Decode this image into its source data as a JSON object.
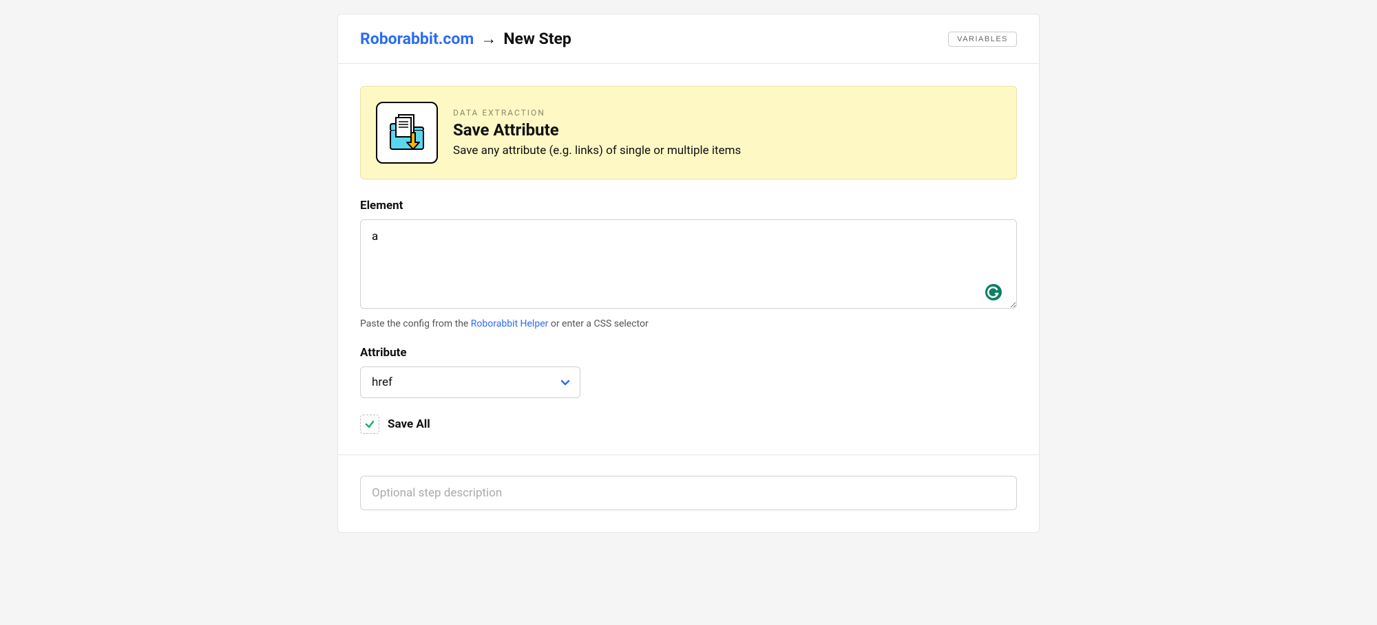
{
  "header": {
    "breadcrumb_link": "Roborabbit.com",
    "breadcrumb_current": "New Step",
    "variables_button": "VARIABLES"
  },
  "step": {
    "eyebrow": "DATA EXTRACTION",
    "title": "Save Attribute",
    "description": "Save any attribute (e.g. links) of single or multiple items"
  },
  "fields": {
    "element": {
      "label": "Element",
      "value": "a",
      "helper_prefix": "Paste the config from the ",
      "helper_link": "Roborabbit Helper",
      "helper_suffix": " or enter a CSS selector"
    },
    "attribute": {
      "label": "Attribute",
      "value": "href"
    },
    "save_all": {
      "label": "Save All",
      "checked": true
    },
    "description_input": {
      "placeholder": "Optional step description",
      "value": ""
    }
  }
}
